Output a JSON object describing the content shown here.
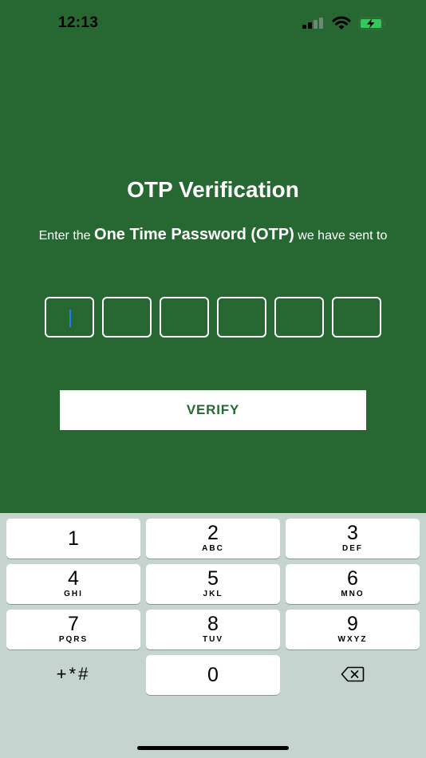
{
  "status_bar": {
    "time": "12:13"
  },
  "screen": {
    "title": "OTP Verification",
    "subtitle_prefix": "Enter the",
    "subtitle_strong": "One Time Password (OTP)",
    "subtitle_suffix": "we have sent to",
    "verify_label": "VERIFY",
    "otp_values": [
      "",
      "",
      "",
      "",
      "",
      ""
    ]
  },
  "colors": {
    "background": "#276832",
    "keyboard": "#c5d4cf",
    "cursor": "#1e7cff"
  },
  "keyboard": {
    "keys": [
      {
        "num": "1",
        "letters": ""
      },
      {
        "num": "2",
        "letters": "ABC"
      },
      {
        "num": "3",
        "letters": "DEF"
      },
      {
        "num": "4",
        "letters": "GHI"
      },
      {
        "num": "5",
        "letters": "JKL"
      },
      {
        "num": "6",
        "letters": "MNO"
      },
      {
        "num": "7",
        "letters": "PQRS"
      },
      {
        "num": "8",
        "letters": "TUV"
      },
      {
        "num": "9",
        "letters": "WXYZ"
      },
      {
        "num": "0",
        "letters": ""
      }
    ],
    "symbols_label": "+*#",
    "delete_icon": "backspace-icon"
  }
}
